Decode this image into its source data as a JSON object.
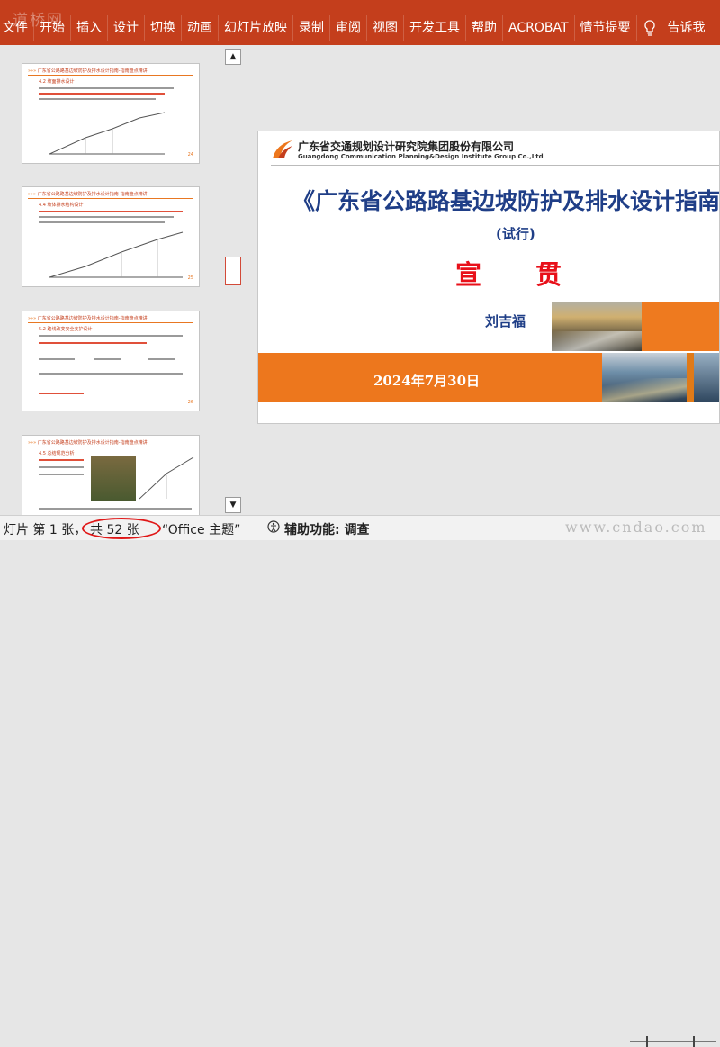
{
  "watermark_top": "道桥网",
  "watermark_bottom": "www.cndao.com",
  "ribbon": {
    "tabs": [
      "文件",
      "开始",
      "插入",
      "设计",
      "切换",
      "动画",
      "幻灯片放映",
      "录制",
      "审阅",
      "视图",
      "开发工具",
      "帮助",
      "ACROBAT",
      "情节提要"
    ],
    "tell_me": "告诉我"
  },
  "thumbnails": [
    {
      "header": "广东省公路路基边坡防护及排水设计指南-指南盘点精讲",
      "section": "4.2 坡面排水设计",
      "page": "24"
    },
    {
      "header": "广东省公路路基边坡防护及排水设计指南-指南盘点精讲",
      "section": "4.4 坡体排水结构设计",
      "page": "25"
    },
    {
      "header": "广东省公路路基边坡防护及排水设计指南-指南盘点精讲",
      "section": "5.2 路线改变安全支护设计",
      "page": "26"
    },
    {
      "header": "广东省公路路基边坡防护及排水设计指南-指南盘点精讲",
      "section": "4.5 总结规范分析",
      "page": "27"
    }
  ],
  "slide": {
    "company_cn": "广东省交通规划设计研究院集团股份有限公司",
    "company_en": "Guangdong Communication Planning&Design Institute Group Co.,Ltd",
    "title": "《广东省公路路基边坡防护及排水设计指南》",
    "subtitle": "(试行)",
    "xuanguan": "宣贯",
    "author": "刘吉福",
    "date": "2024年7月30日"
  },
  "status": {
    "slide_info": "灯片 第 1 张，",
    "total": "共 52 张",
    "theme": "“Office 主题”",
    "accessibility": "辅助功能: 调查"
  },
  "colors": {
    "ribbon": "#c43e1c",
    "title_blue": "#1f3e87",
    "accent_orange": "#ed771d",
    "red": "#e8101a"
  }
}
